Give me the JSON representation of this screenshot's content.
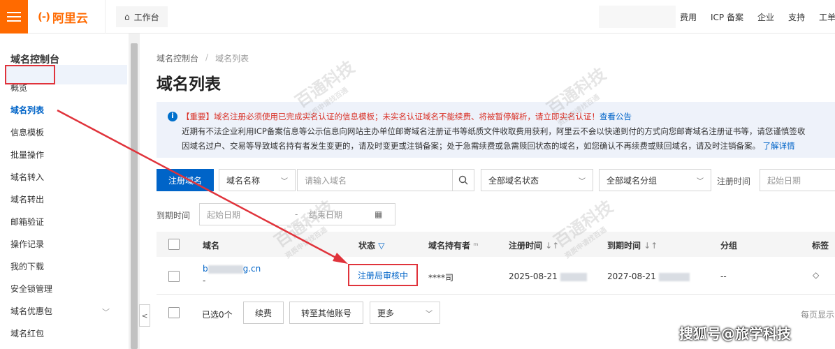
{
  "topbar": {
    "logo_text": "阿里云",
    "logo_mark": "(-)",
    "workbench": "工作台",
    "links": [
      "费用",
      "ICP 备案",
      "企业",
      "支持",
      "工单"
    ]
  },
  "sidebar": {
    "title": "域名控制台",
    "items": [
      "概览",
      "域名列表",
      "信息模板",
      "批量操作",
      "域名转入",
      "域名转出",
      "邮箱验证",
      "操作记录",
      "我的下载",
      "安全锁管理",
      "域名优惠包",
      "域名红包"
    ]
  },
  "breadcrumb": [
    "域名控制台",
    "/",
    "域名列表"
  ],
  "page_title": "域名列表",
  "notice": {
    "important": "【重要】域名注册必须使用已完成实名认证的信息模板；未实名认证域名不能续费、将被暂停解析，请立即实名认证！",
    "important_link": "查看公告",
    "line2": "近期有不法企业利用ICP备案信息等公示信息向网站主办单位邮寄域名注册证书等纸质文件收取费用获利，阿里云不会以快递到付的方式向您邮寄域名注册证书等，请您谨慎签收",
    "line3": "因域名过户、交易等导致域名持有者发生变更的，请及时变更或注销备案；处于急需续费或急需赎回状态的域名，如您确认不再续费或赎回域名，请及时注销备案。",
    "line3_link": "了解详情"
  },
  "filters": {
    "register_button": "注册域名",
    "field_select": "域名名称",
    "search_placeholder": "请输入域名",
    "status_select": "全部域名状态",
    "group_select": "全部域名分组",
    "register_time_label": "注册时间",
    "register_start_placeholder": "起始日期",
    "expire_time_label": "到期时间",
    "expire_start_placeholder": "起始日期",
    "expire_end_placeholder": "结束日期",
    "date_separator": "-"
  },
  "table": {
    "headers": [
      "域名",
      "状态",
      "域名持有者",
      "注册时间",
      "到期时间",
      "分组",
      "标签"
    ],
    "rows": [
      {
        "domain_prefix": "b",
        "domain_suffix": "g.cn",
        "domain_sub": "-",
        "status": "注册局审核中",
        "owner": "****司",
        "registered": "2025-08-21",
        "expires": "2027-08-21",
        "group": "--"
      }
    ]
  },
  "footer": {
    "selected": "已选0个",
    "renew": "续费",
    "transfer": "转至其他账号",
    "more": "更多",
    "per_page": "每页显示"
  },
  "watermarks": {
    "brand": "百通科技",
    "tagline": "资质申请找百通",
    "bottom_credit": "搜狐号@旅学科技"
  },
  "colors": {
    "brand_orange": "#ff6a00",
    "primary_blue": "#0064c8",
    "highlight_red": "#e0333b"
  }
}
